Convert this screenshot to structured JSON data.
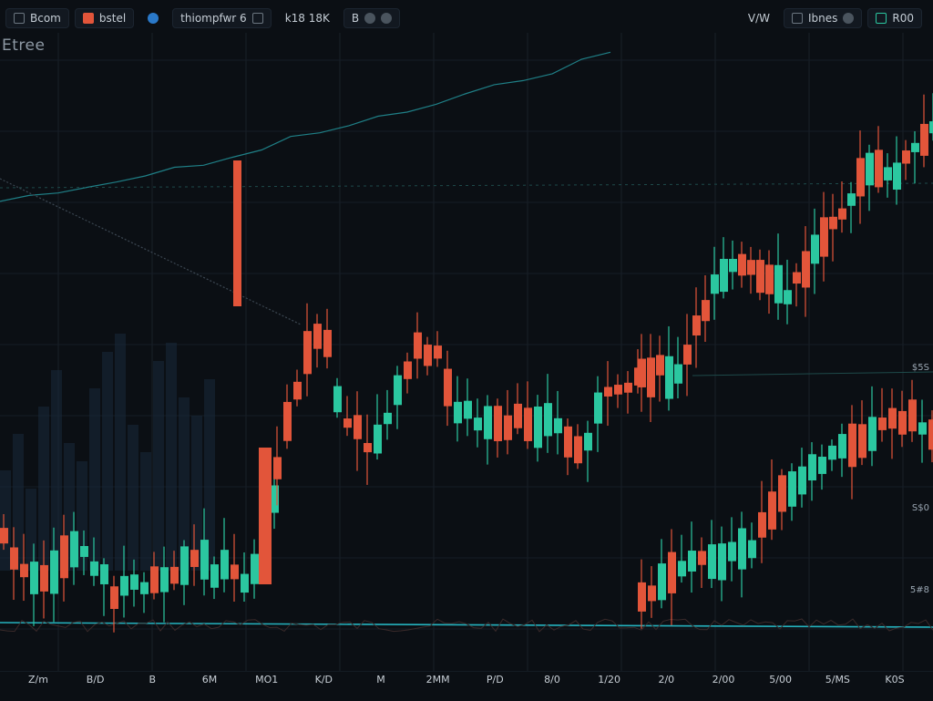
{
  "toolbar": {
    "symbol_button": "Bcom",
    "interval_button": "bstel",
    "indicator_button": "thiompfwr 6",
    "compare_label": "k18 18K",
    "settings_button": "B",
    "right_label": "V/W",
    "zoom_button": "Ibnes",
    "add_button": "R00"
  },
  "chart": {
    "symbol_title": "Etree",
    "y_ticks": [
      "$5S",
      "S$0",
      "5#8"
    ],
    "x_ticks": [
      "Z/m",
      "B/D",
      "B",
      "6M",
      "MO1",
      "K/D",
      "M",
      "2MM",
      "P/D",
      "8/0",
      "1/20",
      "2/0",
      "2/00",
      "5/00",
      "5/MS",
      "K0S"
    ]
  },
  "colors": {
    "background": "#0b0f14",
    "up": "#2bc7a0",
    "down": "#e2553a",
    "trend_line": "#25b3bf"
  },
  "chart_data": {
    "type": "candlestick",
    "title": "Etree",
    "series": [
      {
        "name": "",
        "type": "line",
        "values": [
          16,
          17,
          17,
          18,
          19,
          20,
          21,
          22,
          23,
          24,
          26,
          27,
          28,
          29,
          30,
          31,
          33,
          34,
          35,
          36,
          38,
          39
        ]
      },
      {
        "name": "",
        "type": "trend",
        "values": [
          1,
          1.5,
          2,
          2.5,
          3,
          3.5,
          4,
          4.5,
          5,
          5.5,
          6
        ]
      }
    ],
    "grid": true
  }
}
